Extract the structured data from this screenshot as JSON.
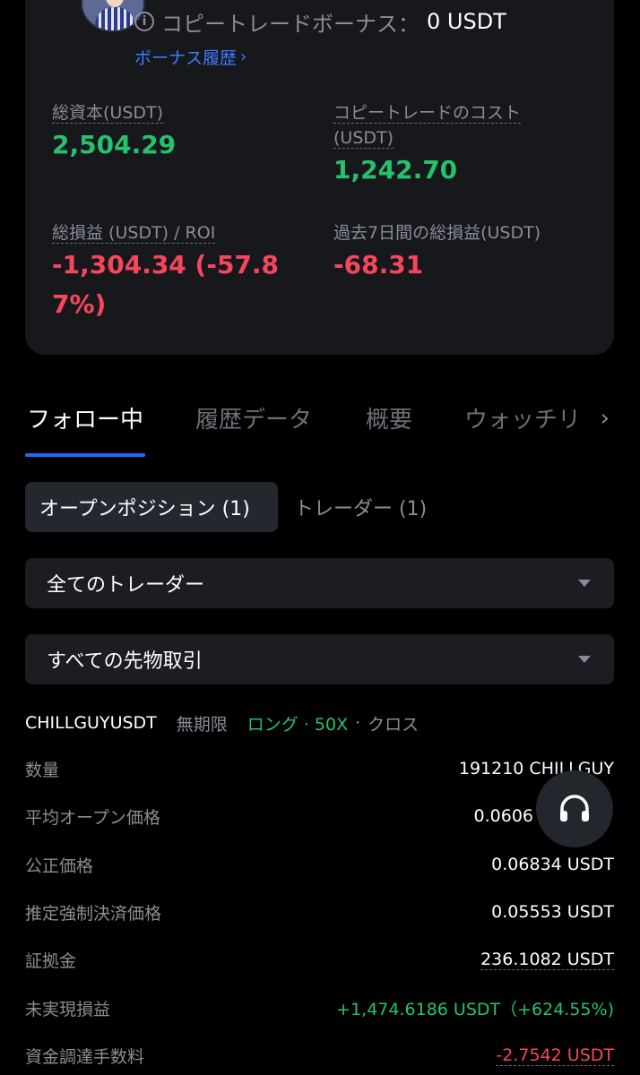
{
  "bonus": {
    "label": "コピートレードボーナス：",
    "value": "0 USDT",
    "history_link": "ボーナス履歴"
  },
  "stats": {
    "total_capital": {
      "label": "総資本(USDT)",
      "value": "2,504.29"
    },
    "copy_cost": {
      "label_line1": "コピートレードのコスト",
      "label_line2": "(USDT)",
      "value": "1,242.70"
    },
    "total_pnl": {
      "label": "総損益 (USDT) / ROI",
      "value_line1": "-1,304.34 (-57.8",
      "value_line2": "7%)"
    },
    "pnl_7d": {
      "label": "過去7日間の総損益(USDT)",
      "value": "-68.31"
    }
  },
  "tabs": [
    "フォロー中",
    "履歴データ",
    "概要",
    "ウォッチリ"
  ],
  "subtabs": {
    "open_positions": "オープンポジション (1)",
    "traders": "トレーダー (1)"
  },
  "filters": {
    "trader": "全てのトレーダー",
    "contract": "すべての先物取引"
  },
  "position": {
    "symbol": "CHILLGUYUSDT",
    "type": "無期限",
    "side": "ロング · 50X",
    "mode": "クロス",
    "rows": [
      {
        "key": "数量",
        "value": "191210 CHILLGUY"
      },
      {
        "key": "平均オープン価格",
        "value": "0.0606"
      },
      {
        "key": "公正価格",
        "value": "0.06834 USDT"
      },
      {
        "key": "推定強制決済価格",
        "value": "0.05553 USDT"
      },
      {
        "key": "証拠金",
        "value": "236.1082 USDT"
      },
      {
        "key": "未実現損益",
        "value": "+1,474.6186 USDT（+624.55%)"
      },
      {
        "key": "資金調達手数料",
        "value": "-2.7542 USDT"
      }
    ]
  },
  "colors": {
    "accent": "#1f6bff",
    "profit": "#25c26e",
    "loss": "#f6465d",
    "link": "#3d7bff"
  }
}
